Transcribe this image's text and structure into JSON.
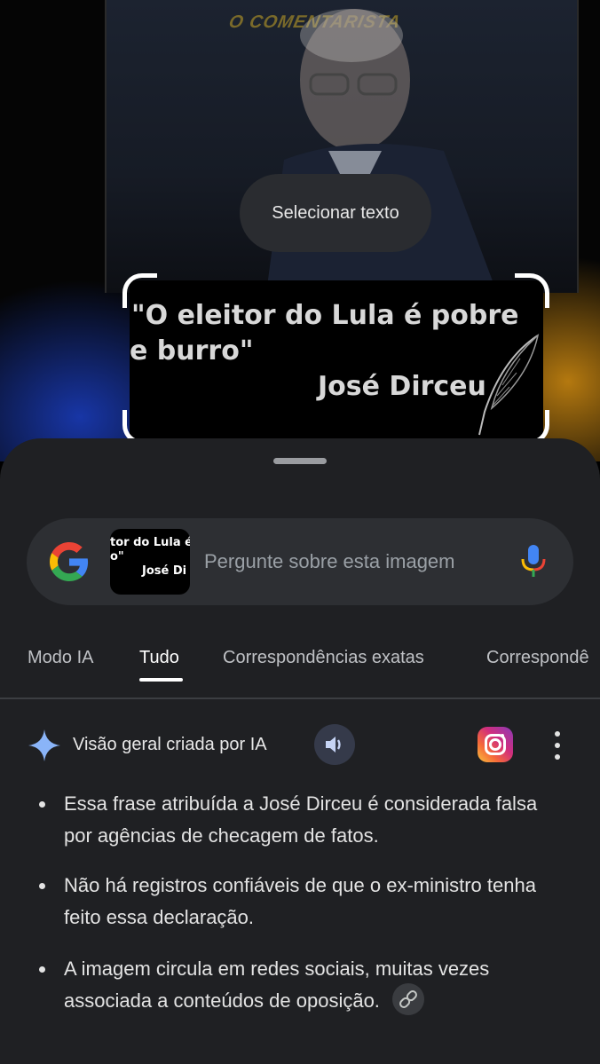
{
  "background": {
    "watermark": "O COMENTARISTA",
    "select_text_label": "Selecionar texto",
    "quote": {
      "line1": "\"O eleitor do Lula é pobre",
      "line2": "e burro\"",
      "author": "José Dirceu"
    }
  },
  "search": {
    "thumb_line1": "tor do Lula é",
    "thumb_line2": "o\"",
    "thumb_line3": "José Di",
    "placeholder": "Pergunte sobre esta imagem"
  },
  "tabs": [
    {
      "label": "Modo IA",
      "active": false
    },
    {
      "label": "Tudo",
      "active": true
    },
    {
      "label": "Correspondências exatas",
      "active": false
    },
    {
      "label": "Correspondê",
      "active": false
    }
  ],
  "ai_overview": {
    "title": "Visão geral criada por IA",
    "bullets": [
      "Essa frase atribuída a José Dirceu é considerada falsa por agências de checagem de fatos.",
      "Não há registros confiáveis de que o ex-ministro tenha feito essa declaração.",
      "A imagem circula em redes sociais, muitas vezes associada a conteúdos de oposição."
    ]
  },
  "colors": {
    "sheet_bg": "#1f2023",
    "search_bg": "#2d2f33",
    "sparkle_blue": "#8ab4f8",
    "google_blue": "#4285F4",
    "google_red": "#EA4335",
    "google_yellow": "#FBBC05",
    "google_green": "#34A853"
  },
  "icons": [
    "google-logo-icon",
    "microphone-icon",
    "sparkle-icon",
    "speaker-icon",
    "instagram-icon",
    "more-vert-icon",
    "link-icon",
    "feather-icon"
  ]
}
